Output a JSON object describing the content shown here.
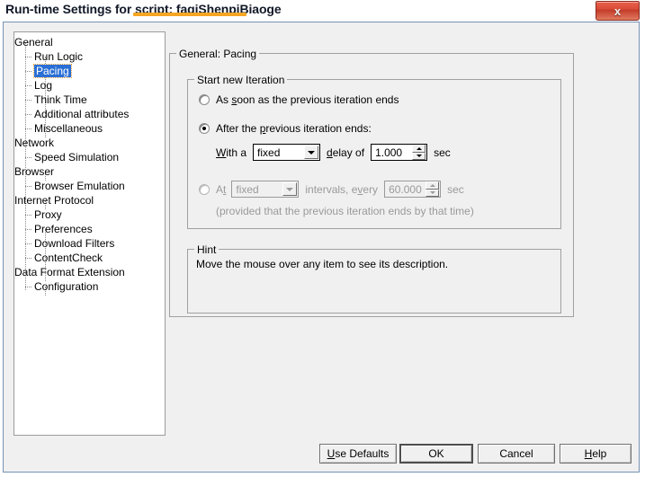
{
  "window": {
    "title": "Run-time Settings for script: faqiShenpiBiaoge",
    "close_label": "x",
    "highlight_color": "#f5a623"
  },
  "tree": {
    "nodes": [
      {
        "label": "General",
        "level": 0,
        "selected": false
      },
      {
        "label": "Run Logic",
        "level": 1,
        "selected": false
      },
      {
        "label": "Pacing",
        "level": 1,
        "selected": true
      },
      {
        "label": "Log",
        "level": 1,
        "selected": false
      },
      {
        "label": "Think Time",
        "level": 1,
        "selected": false
      },
      {
        "label": "Additional attributes",
        "level": 1,
        "selected": false
      },
      {
        "label": "Miscellaneous",
        "level": 1,
        "selected": false
      },
      {
        "label": "Network",
        "level": 0,
        "selected": false
      },
      {
        "label": "Speed Simulation",
        "level": 1,
        "selected": false
      },
      {
        "label": "Browser",
        "level": 0,
        "selected": false
      },
      {
        "label": "Browser Emulation",
        "level": 1,
        "selected": false
      },
      {
        "label": "Internet Protocol",
        "level": 0,
        "selected": false
      },
      {
        "label": "Proxy",
        "level": 1,
        "selected": false
      },
      {
        "label": "Preferences",
        "level": 1,
        "selected": false
      },
      {
        "label": "Download Filters",
        "level": 1,
        "selected": false
      },
      {
        "label": "ContentCheck",
        "level": 1,
        "selected": false
      },
      {
        "label": "Data Format Extension",
        "level": 0,
        "selected": false
      },
      {
        "label": "Configuration",
        "level": 1,
        "selected": false
      }
    ]
  },
  "panel": {
    "legend": "General: Pacing",
    "start_group": {
      "legend": "Start new Iteration",
      "option_asap": {
        "label_before": "As ",
        "label_underlined": "s",
        "label_after": "oon as the previous iteration ends",
        "selected": false
      },
      "option_after": {
        "label_before": "After the ",
        "label_underlined": "p",
        "label_after": "revious iteration ends:",
        "selected": true
      },
      "delay_row": {
        "label_with_u": "W",
        "label_with_rest": "ith a",
        "combo_value": "fixed",
        "label_delay_u": "d",
        "label_delay_rest": "elay of",
        "value": "1.000",
        "unit": "sec",
        "enabled": true
      },
      "option_at": {
        "label_before": "A",
        "label_underlined": "t",
        "selected": false,
        "combo_value": "fixed",
        "label_intervals_before": "intervals, e",
        "label_intervals_underlined": "v",
        "label_intervals_after": "ery",
        "value": "60.000",
        "unit": "sec",
        "enabled": false
      },
      "note": "(provided that the previous iteration ends by that time)"
    },
    "hint_group": {
      "legend": "Hint",
      "text": "Move the mouse over any item to see its description."
    }
  },
  "buttons": {
    "use_defaults_u": "U",
    "use_defaults_rest": "se Defaults",
    "ok": "OK",
    "cancel": "Cancel",
    "help_u": "H",
    "help_rest": "elp"
  }
}
